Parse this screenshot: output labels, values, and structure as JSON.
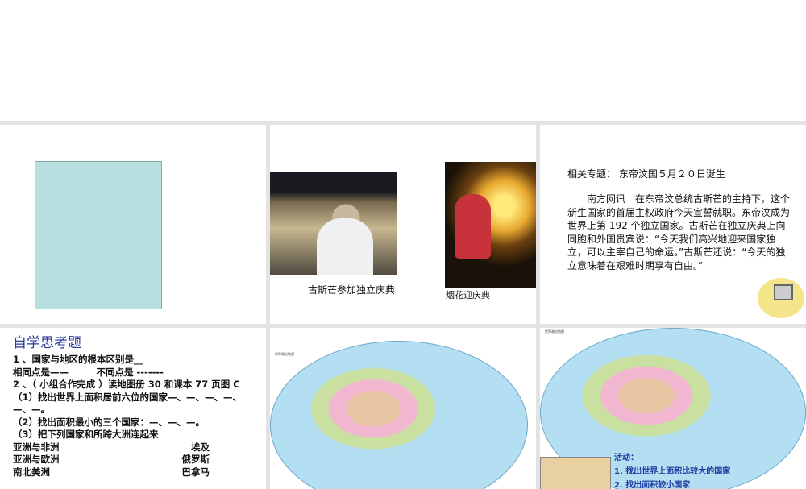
{
  "slide2": {
    "caption1": "古斯芒参加独立庆典",
    "caption2": "烟花迎庆典"
  },
  "slide3": {
    "heading": "相关专题：  东帝汶国５月２０日诞生",
    "body": "　　南方网讯　在东帝汶总统古斯芒的主持下，这个新生国家的首届主权政府今天宣誓就职。东帝汶成为世界上第 192 个独立国家。古斯芒在独立庆典上向同胞和外国贵宾说：“今天我们高兴地迎来国家独立，可以主宰自己的命运。”古斯芒还说：“今天的独立意味着在艰难时期享有自由。”"
  },
  "slide4": {
    "title": "自学思考题",
    "lines": [
      "1 、国家与地区的根本区别是__",
      "相同点是——　　　不同点是 -------",
      "2 、（ 小组合作完成 ）读地图册 30 和课本 77 页图 C",
      "（1）找出世界上面积居前六位的国家—、—、—、—、—、—。",
      "（2）找出面积最小的三个国家：—、—、—。",
      "（3）把下列国家和所跨大洲连起来"
    ],
    "pairs": [
      [
        "亚洲与非洲",
        "埃及"
      ],
      [
        "亚洲与欧洲",
        "俄罗斯"
      ],
      [
        "南北美洲",
        "巴拿马"
      ]
    ]
  },
  "slide5": {
    "map_title": "世界政治地图"
  },
  "slide6": {
    "map_title": "世界政治地图",
    "activity_title": "活动：",
    "activity_1": "1. 找出世界上面积比较大的国家",
    "activity_2": "2. 找出面积较小国家"
  }
}
